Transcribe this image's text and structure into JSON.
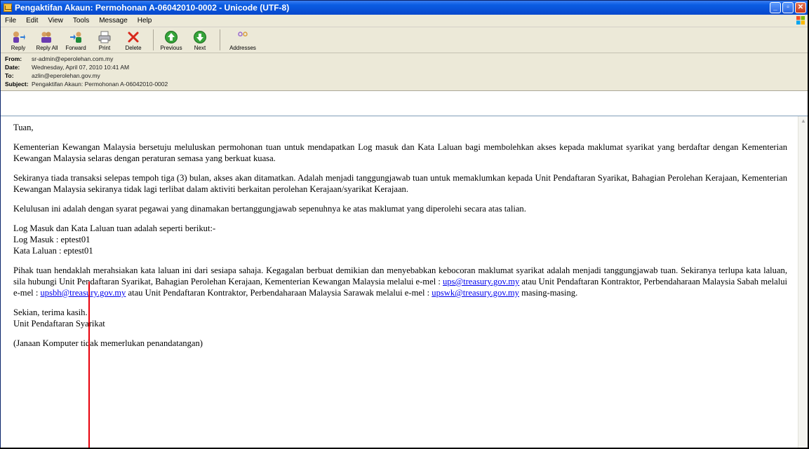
{
  "window": {
    "title": "Pengaktifan Akaun: Permohonan A-06042010-0002 - Unicode (UTF-8)"
  },
  "menu": [
    "File",
    "Edit",
    "View",
    "Tools",
    "Message",
    "Help"
  ],
  "toolbar": {
    "reply": "Reply",
    "reply_all": "Reply All",
    "forward": "Forward",
    "print": "Print",
    "delete": "Delete",
    "previous": "Previous",
    "next": "Next",
    "addresses": "Addresses"
  },
  "headers": {
    "from_label": "From:",
    "from": "sr-admin@eperolehan.com.my",
    "date_label": "Date:",
    "date": "Wednesday, April 07, 2010 10:41 AM",
    "to_label": "To:",
    "to": "azlin@eperolehan.gov.my",
    "subject_label": "Subject:",
    "subject": "Pengaktifan Akaun: Permohonan A-06042010-0002"
  },
  "body": {
    "greeting": "Tuan,",
    "p1": "Kementerian Kewangan Malaysia bersetuju meluluskan permohonan tuan untuk mendapatkan Log masuk dan Kata Laluan bagi membolehkan akses kepada maklumat syarikat yang berdaftar dengan Kementerian Kewangan Malaysia selaras dengan peraturan semasa yang berkuat kuasa.",
    "p2": "Sekiranya tiada transaksi selepas tempoh tiga (3) bulan, akses akan ditamatkan. Adalah menjadi tanggungjawab tuan untuk memaklumkan kepada Unit Pendaftaran Syarikat, Bahagian Perolehan Kerajaan, Kementerian Kewangan Malaysia sekiranya tidak lagi terlibat dalam aktiviti berkaitan perolehan Kerajaan/syarikat Kerajaan.",
    "p3": "Kelulusan ini adalah dengan syarat pegawai yang dinamakan bertanggungjawab sepenuhnya ke atas maklumat yang diperolehi secara atas talian.",
    "login_intro": "Log Masuk dan Kata Laluan tuan adalah seperti berikut:-",
    "login_line": "Log Masuk : eptest01",
    "password_line": "Kata Laluan : eptest01",
    "p4_a": "Pihak tuan hendaklah merahsiakan kata laluan ini dari sesiapa sahaja. Kegagalan berbuat demikian dan menyebabkan kebocoran maklumat syarikat adalah menjadi tanggungjawab tuan. Sekiranya terlupa kata laluan, sila hubungi Unit Pendaftaran Syarikat, Bahagian Perolehan Kerajaan, Kementerian Kewangan Malaysia melalui e-mel : ",
    "link1": "ups@treasury.gov.my",
    "p4_b": " atau Unit Pendaftaran Kontraktor, Perbendaharaan Malaysia Sabah melalui e-mel : ",
    "link2": "upsbh@treasury.gov.my",
    "p4_c": " atau Unit Pendaftaran Kontraktor, Perbendaharaan Malaysia Sarawak melalui e-mel : ",
    "link3": "upswk@treasury.gov.my",
    "p4_d": " masing-masing.",
    "closing1": "Sekian, terima kasih.",
    "closing2": "Unit Pendaftaran Syarikat",
    "footer": "(Janaan Komputer tidak memerlukan penandatangan)"
  }
}
